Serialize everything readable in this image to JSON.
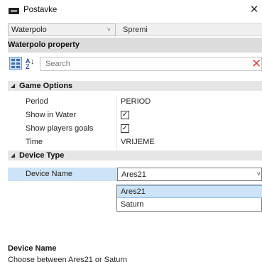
{
  "window": {
    "title": "Postavke",
    "icon": "app-window-icon",
    "close_symbol": "✕"
  },
  "top_bar": {
    "dropdown_value": "Waterpolo",
    "dropdown_arrow": "˅",
    "save_label": "Spremi"
  },
  "property_panel": {
    "header": "Waterpolo property"
  },
  "toolbar": {
    "categorized_icon": "categorized-view-icon",
    "alphabetical_icon": "alphabetical-sort-icon",
    "alpha_text": "A\nZ",
    "alpha_arrow": "↓",
    "search_placeholder": "Search",
    "clear_symbol": "✕"
  },
  "categories": [
    {
      "label": "Game Options",
      "toggle": "◢",
      "properties": [
        {
          "name": "Period",
          "value": "PERIOD"
        },
        {
          "name": "Show in Water",
          "checked": true,
          "check_symbol": "✓"
        },
        {
          "name": "Show players goals",
          "checked": true,
          "check_symbol": "✓"
        },
        {
          "name": "Time",
          "value": "VRIJEME"
        }
      ]
    },
    {
      "label": "Device Type",
      "toggle": "◢",
      "properties": [
        {
          "name": "Device Name",
          "value": "Ares21",
          "selected": true,
          "arrow": "˅"
        }
      ]
    }
  ],
  "device_dropdown": {
    "options": [
      "Ares21",
      "Saturn"
    ],
    "highlighted": "Ares21"
  },
  "description": {
    "title": "Device Name",
    "text": "Choose between Ares21 or Saturn"
  }
}
